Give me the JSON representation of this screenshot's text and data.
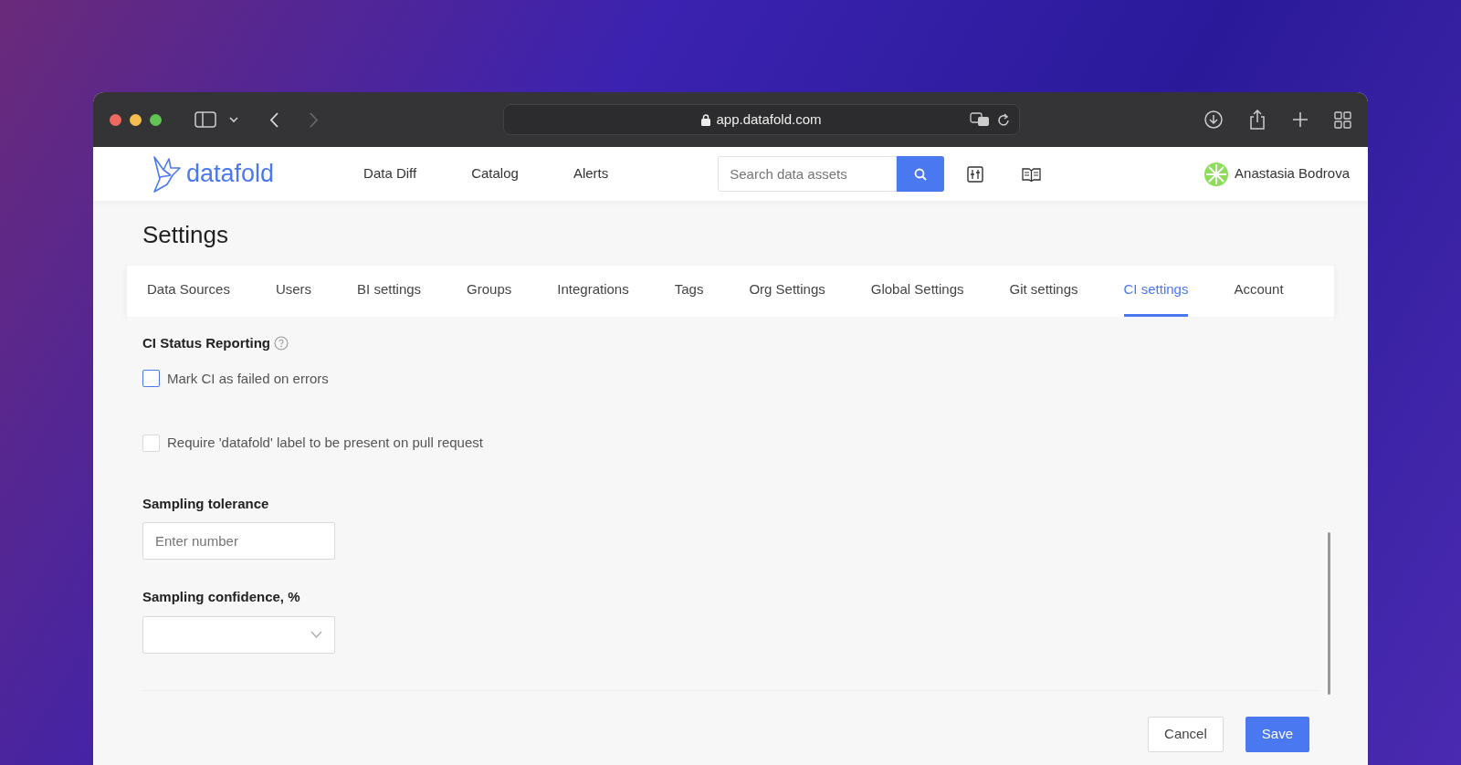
{
  "browser": {
    "address": "app.datafold.com"
  },
  "header": {
    "logo_text": "datafold",
    "nav": [
      {
        "label": "Data Diff"
      },
      {
        "label": "Catalog"
      },
      {
        "label": "Alerts"
      }
    ],
    "search": {
      "placeholder": "Search data assets"
    },
    "user": {
      "name": "Anastasia Bodrova"
    }
  },
  "page": {
    "title": "Settings"
  },
  "tabs": [
    {
      "label": "Data Sources",
      "selected": false
    },
    {
      "label": "Users",
      "selected": false
    },
    {
      "label": "BI settings",
      "selected": false
    },
    {
      "label": "Groups",
      "selected": false
    },
    {
      "label": "Integrations",
      "selected": false
    },
    {
      "label": "Tags",
      "selected": false
    },
    {
      "label": "Org Settings",
      "selected": false
    },
    {
      "label": "Global Settings",
      "selected": false
    },
    {
      "label": "Git settings",
      "selected": false
    },
    {
      "label": "CI settings",
      "selected": true
    },
    {
      "label": "Account",
      "selected": false
    }
  ],
  "section": {
    "title": "CI Status Reporting"
  },
  "checkboxes": [
    {
      "label": "Mark CI as failed on errors",
      "checked": false,
      "hovered": true
    },
    {
      "label": "Require 'datafold' label to be present on pull request",
      "checked": false,
      "hovered": false
    }
  ],
  "fields": [
    {
      "kind": "input",
      "label": "Sampling tolerance",
      "placeholder": "Enter number"
    },
    {
      "kind": "select",
      "label": "Sampling confidence, %"
    }
  ],
  "buttons": [
    {
      "label": "Cancel",
      "kind": "secondary"
    },
    {
      "label": "Save",
      "kind": "primary"
    }
  ]
}
